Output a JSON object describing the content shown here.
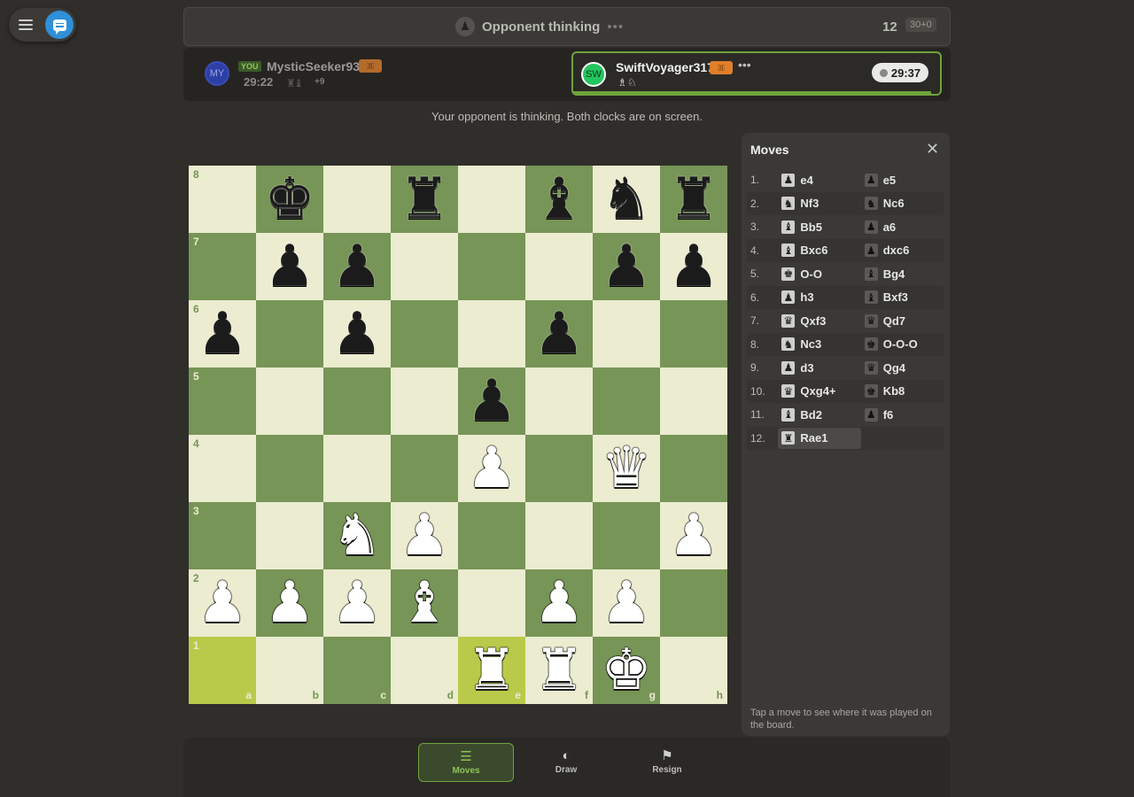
{
  "controls": {
    "menu_icon": "hamburger-menu-icon",
    "chat_icon": "chat-bubble-icon"
  },
  "status": {
    "text": "Opponent thinking",
    "dots": "•••",
    "move_number": "12",
    "time_control": "30+0"
  },
  "me": {
    "avatar": "MY",
    "tag": "YOU",
    "name": "MysticSeeker931",
    "flag": "🇧",
    "clock": "29:22",
    "captured": "♜♝",
    "advantage": "+9"
  },
  "opponent": {
    "avatar": "SW",
    "name": "SwiftVoyager317",
    "flag": "🇧",
    "more": "•••",
    "captured": "♗♘",
    "clock": "29:37"
  },
  "notice": "Your opponent is thinking. Both clocks are on screen.",
  "board": {
    "highlight": [
      "a1",
      "e1"
    ],
    "squares": [
      {
        "rank": "8",
        "cells": [
          "",
          "♚",
          "",
          "♜",
          "",
          "♝",
          "♞",
          "♜"
        ],
        "colors": [
          "",
          "b",
          "",
          "b",
          "",
          "b",
          "b",
          "b"
        ]
      },
      {
        "rank": "7",
        "cells": [
          "",
          "♟",
          "♟",
          "",
          "",
          "",
          "♟",
          "♟"
        ],
        "colors": [
          "",
          "b",
          "b",
          "",
          "",
          "",
          "b",
          "b"
        ]
      },
      {
        "rank": "6",
        "cells": [
          "♟",
          "",
          "♟",
          "",
          "",
          "♟",
          "",
          ""
        ],
        "colors": [
          "b",
          "",
          "b",
          "",
          "",
          "b",
          "",
          ""
        ]
      },
      {
        "rank": "5",
        "cells": [
          "",
          "",
          "",
          "",
          "♟",
          "",
          "",
          ""
        ],
        "colors": [
          "",
          "",
          "",
          "",
          "b",
          "",
          "",
          ""
        ]
      },
      {
        "rank": "4",
        "cells": [
          "",
          "",
          "",
          "",
          "♟",
          "",
          "♛",
          ""
        ],
        "colors": [
          "",
          "",
          "",
          "",
          "w",
          "",
          "w",
          ""
        ]
      },
      {
        "rank": "3",
        "cells": [
          "",
          "",
          "♞",
          "♟",
          "",
          "",
          "",
          "♟"
        ],
        "colors": [
          "",
          "",
          "w",
          "w",
          "",
          "",
          "",
          "w"
        ]
      },
      {
        "rank": "2",
        "cells": [
          "♟",
          "♟",
          "♟",
          "♝",
          "",
          "♟",
          "♟",
          ""
        ],
        "colors": [
          "w",
          "w",
          "w",
          "w",
          "",
          "w",
          "w",
          ""
        ]
      },
      {
        "rank": "1",
        "cells": [
          "",
          "",
          "",
          "",
          "♜",
          "♜",
          "♚",
          ""
        ],
        "colors": [
          "",
          "",
          "",
          "",
          "w",
          "w",
          "w",
          ""
        ]
      }
    ],
    "files": [
      "a",
      "b",
      "c",
      "d",
      "e",
      "f",
      "g",
      "h"
    ]
  },
  "panel": {
    "title": "Moves",
    "close_icon": "close-icon",
    "footer": "Tap a move to see where it was played on the board.",
    "moves": [
      {
        "n": "1.",
        "w": {
          "i": "♟",
          "s": "e4"
        },
        "b": {
          "i": "♟",
          "s": "e5"
        }
      },
      {
        "n": "2.",
        "w": {
          "i": "♞",
          "s": "Nf3"
        },
        "b": {
          "i": "♞",
          "s": "Nc6"
        }
      },
      {
        "n": "3.",
        "w": {
          "i": "♝",
          "s": "Bb5"
        },
        "b": {
          "i": "♟",
          "s": "a6"
        }
      },
      {
        "n": "4.",
        "w": {
          "i": "♝",
          "s": "Bxc6"
        },
        "b": {
          "i": "♟",
          "s": "dxc6"
        }
      },
      {
        "n": "5.",
        "w": {
          "i": "♚",
          "s": "O-O"
        },
        "b": {
          "i": "♝",
          "s": "Bg4"
        }
      },
      {
        "n": "6.",
        "w": {
          "i": "♟",
          "s": "h3"
        },
        "b": {
          "i": "♝",
          "s": "Bxf3"
        }
      },
      {
        "n": "7.",
        "w": {
          "i": "♛",
          "s": "Qxf3"
        },
        "b": {
          "i": "♛",
          "s": "Qd7"
        }
      },
      {
        "n": "8.",
        "w": {
          "i": "♞",
          "s": "Nc3"
        },
        "b": {
          "i": "♚",
          "s": "O-O-O"
        }
      },
      {
        "n": "9.",
        "w": {
          "i": "♟",
          "s": "d3"
        },
        "b": {
          "i": "♛",
          "s": "Qg4"
        }
      },
      {
        "n": "10.",
        "w": {
          "i": "♛",
          "s": "Qxg4+"
        },
        "b": {
          "i": "♚",
          "s": "Kb8"
        }
      },
      {
        "n": "11.",
        "w": {
          "i": "♝",
          "s": "Bd2"
        },
        "b": {
          "i": "♟",
          "s": "f6"
        }
      },
      {
        "n": "12.",
        "w": {
          "i": "♜",
          "s": "Rae1"
        },
        "b": null
      }
    ]
  },
  "toolbar": {
    "moves": {
      "label": "Moves",
      "icon": "☰"
    },
    "draw": {
      "label": "Draw",
      "icon": "◐"
    },
    "resign": {
      "label": "Resign",
      "icon": "⚑"
    }
  }
}
